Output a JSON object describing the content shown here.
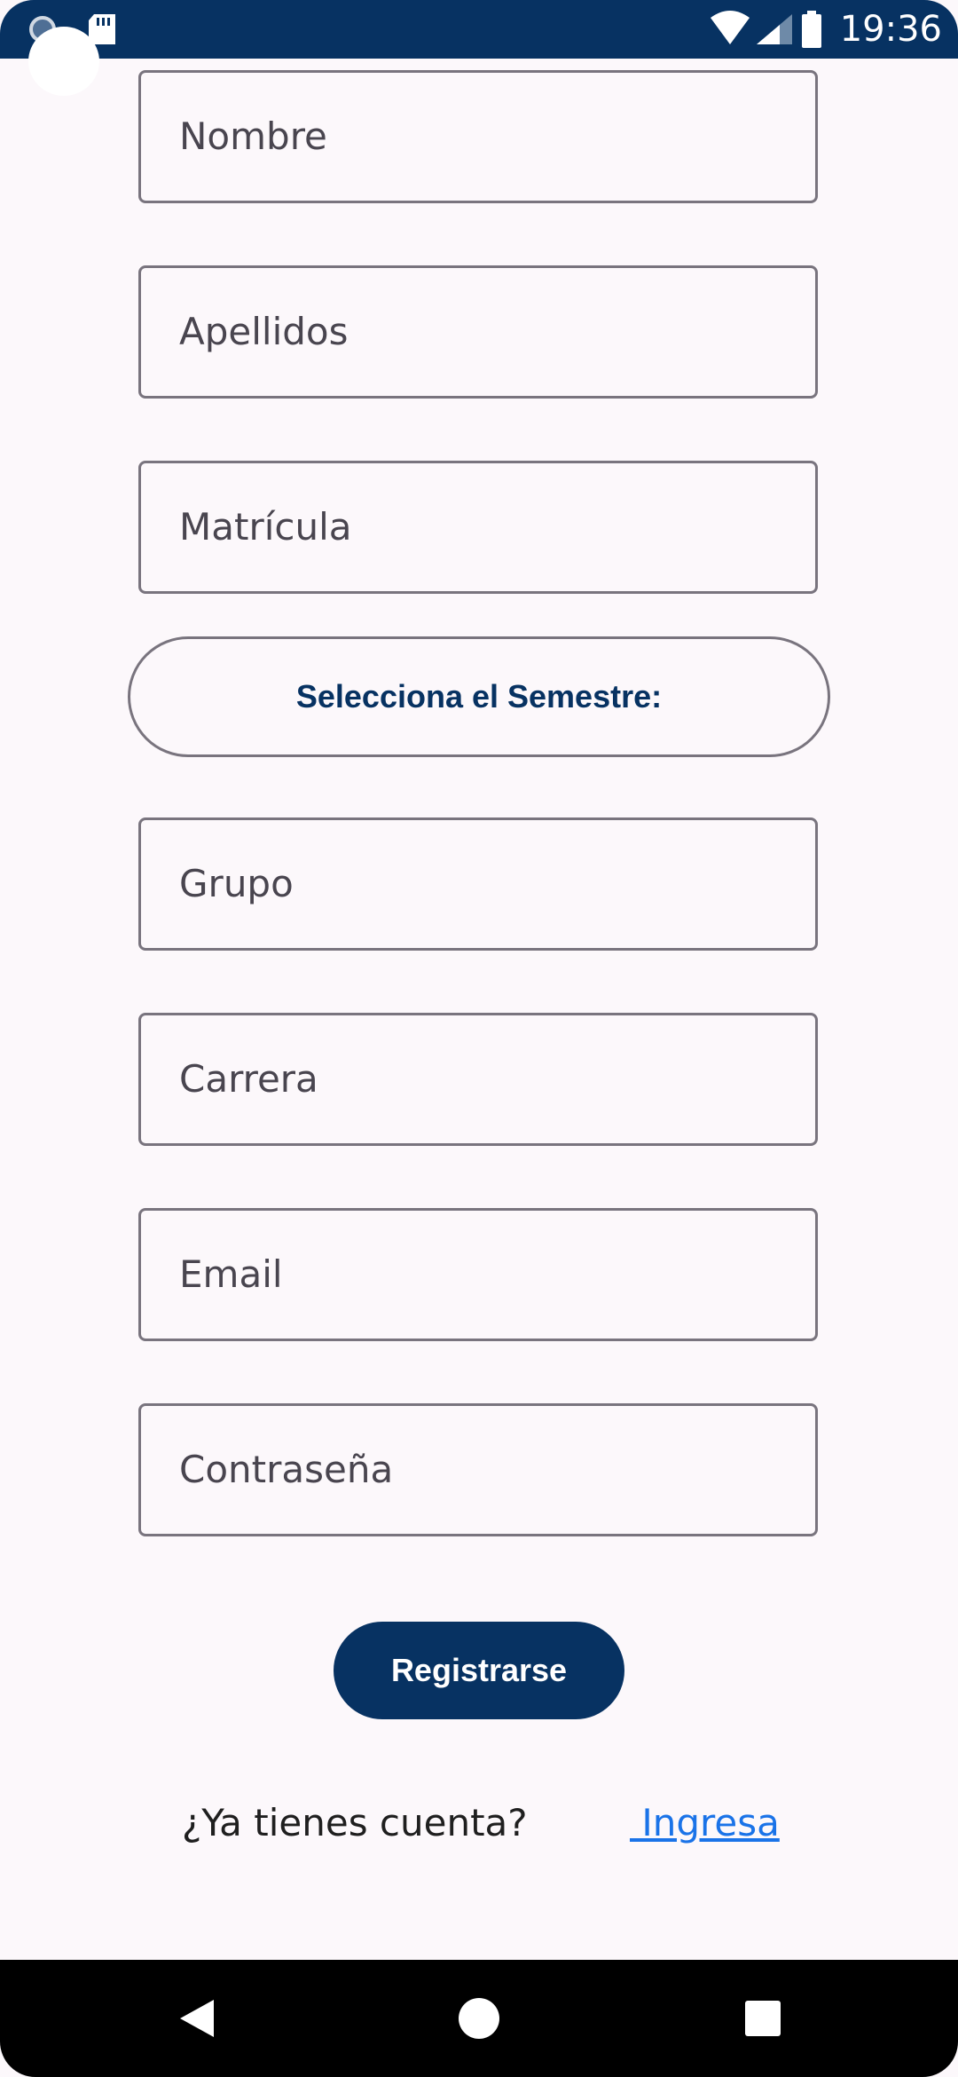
{
  "status_bar": {
    "time": "19:36",
    "icons": [
      "camera-icon",
      "sd-card-icon",
      "wifi-icon",
      "signal-icon",
      "battery-icon"
    ]
  },
  "form": {
    "fields": [
      {
        "label": "Nombre"
      },
      {
        "label": "Apellidos"
      },
      {
        "label": "Matrícula"
      },
      {
        "label": "Grupo"
      },
      {
        "label": "Carrera"
      },
      {
        "label": "Email"
      },
      {
        "label": "Contraseña"
      }
    ],
    "semester_button": "Selecciona el Semestre:",
    "register_button": "Registrarse"
  },
  "footer": {
    "question": "¿Ya tienes cuenta?",
    "login_link": " Ingresa"
  },
  "nav_bar": {
    "icons": [
      "back-icon",
      "home-icon",
      "recents-icon"
    ]
  },
  "colors": {
    "primary": "#073262",
    "background": "#fcf8fb",
    "outline": "#79747e",
    "link": "#1a73e8"
  }
}
